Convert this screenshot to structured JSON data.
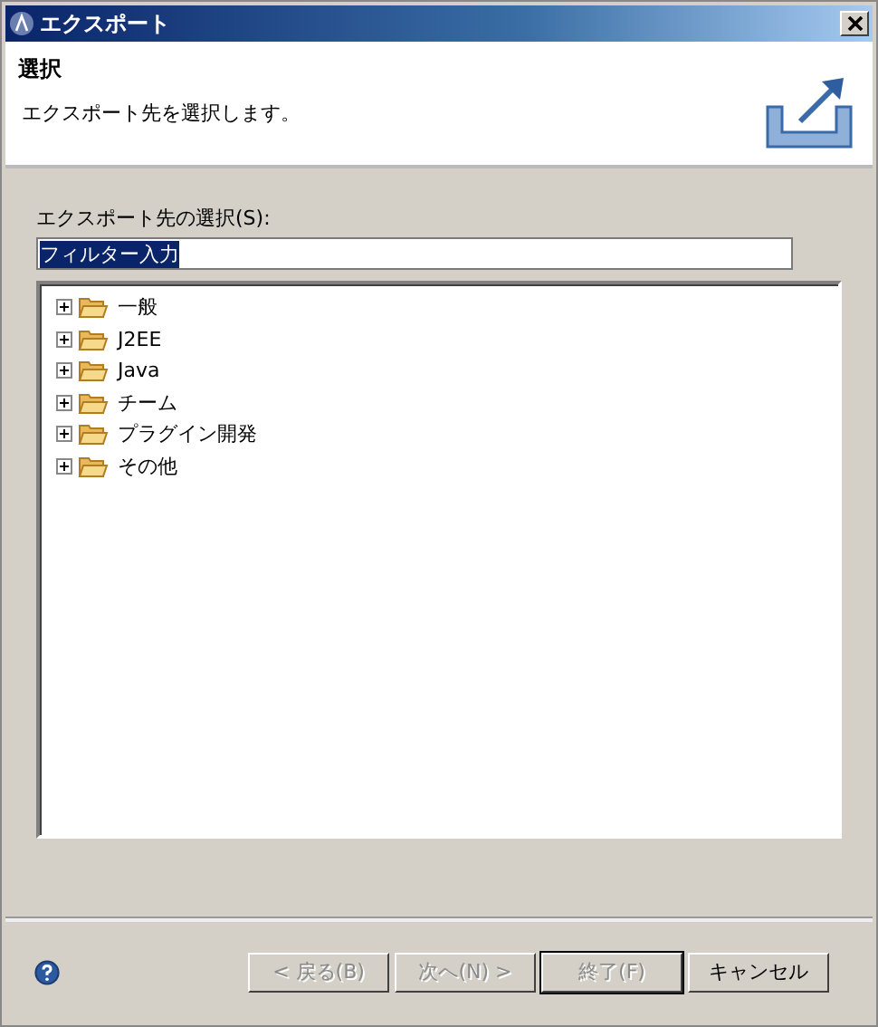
{
  "window": {
    "title": "エクスポート"
  },
  "header": {
    "title": "選択",
    "description": "エクスポート先を選択します。"
  },
  "filter": {
    "label": "エクスポート先の選択(S):",
    "value": "フィルター入力",
    "selected": true
  },
  "tree": [
    {
      "label": "一般",
      "expanded": false
    },
    {
      "label": "J2EE",
      "expanded": false
    },
    {
      "label": "Java",
      "expanded": false
    },
    {
      "label": "チーム",
      "expanded": false
    },
    {
      "label": "プラグイン開発",
      "expanded": false
    },
    {
      "label": "その他",
      "expanded": false
    }
  ],
  "buttons": [
    {
      "label": "< 戻る(B)",
      "disabled": true,
      "default": false
    },
    {
      "label": "次へ(N) >",
      "disabled": true,
      "default": false
    },
    {
      "label": "終了(F)",
      "disabled": true,
      "default": true
    },
    {
      "label": "キャンセル",
      "disabled": false,
      "default": false
    }
  ]
}
